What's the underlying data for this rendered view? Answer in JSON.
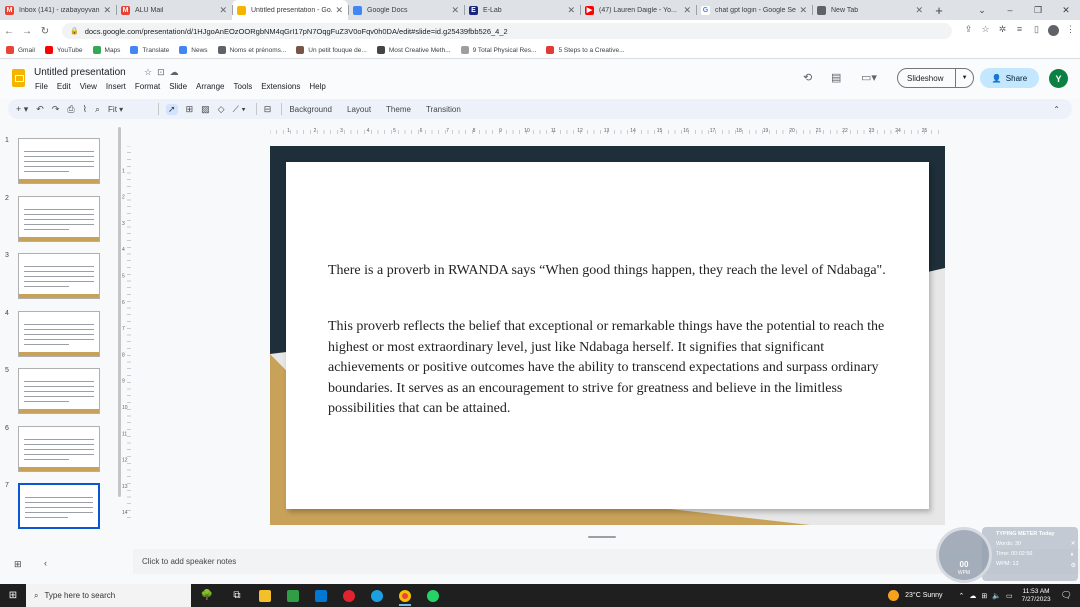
{
  "browser": {
    "tabs": [
      {
        "title": "Inbox (141) - izabayoyvan...",
        "icon": "gmail-icon",
        "color": "#ea4335",
        "glyph": "M",
        "active": false
      },
      {
        "title": "ALU Mail",
        "icon": "gmail-icon",
        "color": "#ea4335",
        "glyph": "M",
        "active": false
      },
      {
        "title": "Untitled presentation - Go...",
        "icon": "slides-icon",
        "color": "#f4b400",
        "glyph": "",
        "active": true
      },
      {
        "title": "Google Docs",
        "icon": "docs-icon",
        "color": "#4285f4",
        "glyph": "",
        "active": false
      },
      {
        "title": "E-Lab",
        "icon": "elab-icon",
        "color": "#1a237e",
        "glyph": "E",
        "active": false
      },
      {
        "title": "(47) Lauren Daigle - Yo...",
        "icon": "youtube-icon",
        "color": "#ff0000",
        "glyph": "▶",
        "active": false
      },
      {
        "title": "chat gpt login - Google Se...",
        "icon": "google-icon",
        "color": "#ffffff",
        "glyph": "G",
        "active": false
      },
      {
        "title": "New Tab",
        "icon": "chrome-icon",
        "color": "#5f6368",
        "glyph": "",
        "active": false
      }
    ],
    "url": "docs.google.com/presentation/d/1HJgoAnEOzOORgbNM4qGrI17pN7OqgFuZ3V0oFqv0h0DA/edit#slide=id.g25439fbb526_4_2",
    "bookmarks": [
      {
        "label": "Gmail",
        "color": "#ea4335"
      },
      {
        "label": "YouTube",
        "color": "#ff0000"
      },
      {
        "label": "Maps",
        "color": "#34a853"
      },
      {
        "label": "Translate",
        "color": "#4285f4"
      },
      {
        "label": "News",
        "color": "#4285f4"
      },
      {
        "label": "Noms et prénoms...",
        "color": "#5f6368"
      },
      {
        "label": "Un petit fouque de...",
        "color": "#795548"
      },
      {
        "label": "Most Creative Meth...",
        "color": "#444444"
      },
      {
        "label": "9 Total Physical Res...",
        "color": "#9e9e9e"
      },
      {
        "label": "5 Steps to a Creative...",
        "color": "#e53935"
      }
    ]
  },
  "docs": {
    "title": "Untitled presentation",
    "menu": [
      "File",
      "Edit",
      "View",
      "Insert",
      "Format",
      "Slide",
      "Arrange",
      "Tools",
      "Extensions",
      "Help"
    ],
    "slideshow_label": "Slideshow",
    "share_label": "Share",
    "avatar_letter": "Y",
    "zoom": "Fit",
    "toolbar_text": [
      "Background",
      "Layout",
      "Theme",
      "Transition"
    ]
  },
  "filmstrip": {
    "slides": [
      {
        "number": "1",
        "selected": false
      },
      {
        "number": "2",
        "selected": false
      },
      {
        "number": "3",
        "selected": false
      },
      {
        "number": "4",
        "selected": false
      },
      {
        "number": "5",
        "selected": false
      },
      {
        "number": "6",
        "selected": false
      },
      {
        "number": "7",
        "selected": true
      }
    ]
  },
  "ruler_h_labels": [
    "1",
    "2",
    "3",
    "4",
    "5",
    "6",
    "7",
    "8",
    "9",
    "10",
    "11",
    "12",
    "13",
    "14",
    "15",
    "16",
    "17",
    "18",
    "19",
    "20",
    "21",
    "22",
    "23",
    "24",
    "25"
  ],
  "ruler_v_labels": [
    "1",
    "2",
    "3",
    "4",
    "5",
    "6",
    "7",
    "8",
    "9",
    "10",
    "11",
    "12",
    "13",
    "14"
  ],
  "slide": {
    "paragraph1": "There is a proverb in RWANDA says “When good things happen, they reach the level of Ndabaga\".",
    "paragraph2": "This proverb reflects the belief that exceptional or remarkable things have the potential to reach the highest or most extraordinary level, just like Ndabaga herself. It signifies that significant achievements or positive outcomes have the ability to transcend expectations and surpass ordinary boundaries. It serves as an encouragement to strive for greatness and believe in the limitless possibilities that can be attained.",
    "colors": {
      "dark": "#1e2f3a",
      "gold": "#c9a25a"
    }
  },
  "speaker_notes_placeholder": "Click to add speaker notes",
  "typing_meter": {
    "title": "TYPING METER Today",
    "words_label": "Words: 30",
    "time_label": "Time: 00:02:56",
    "wpm_label": "WPM: 13",
    "dial_value": "00",
    "dial_unit": "WPM"
  },
  "taskbar": {
    "search_placeholder": "Type here to search",
    "weather": "23°C  Sunny",
    "time": "11:53 AM",
    "date": "7/27/2023"
  }
}
